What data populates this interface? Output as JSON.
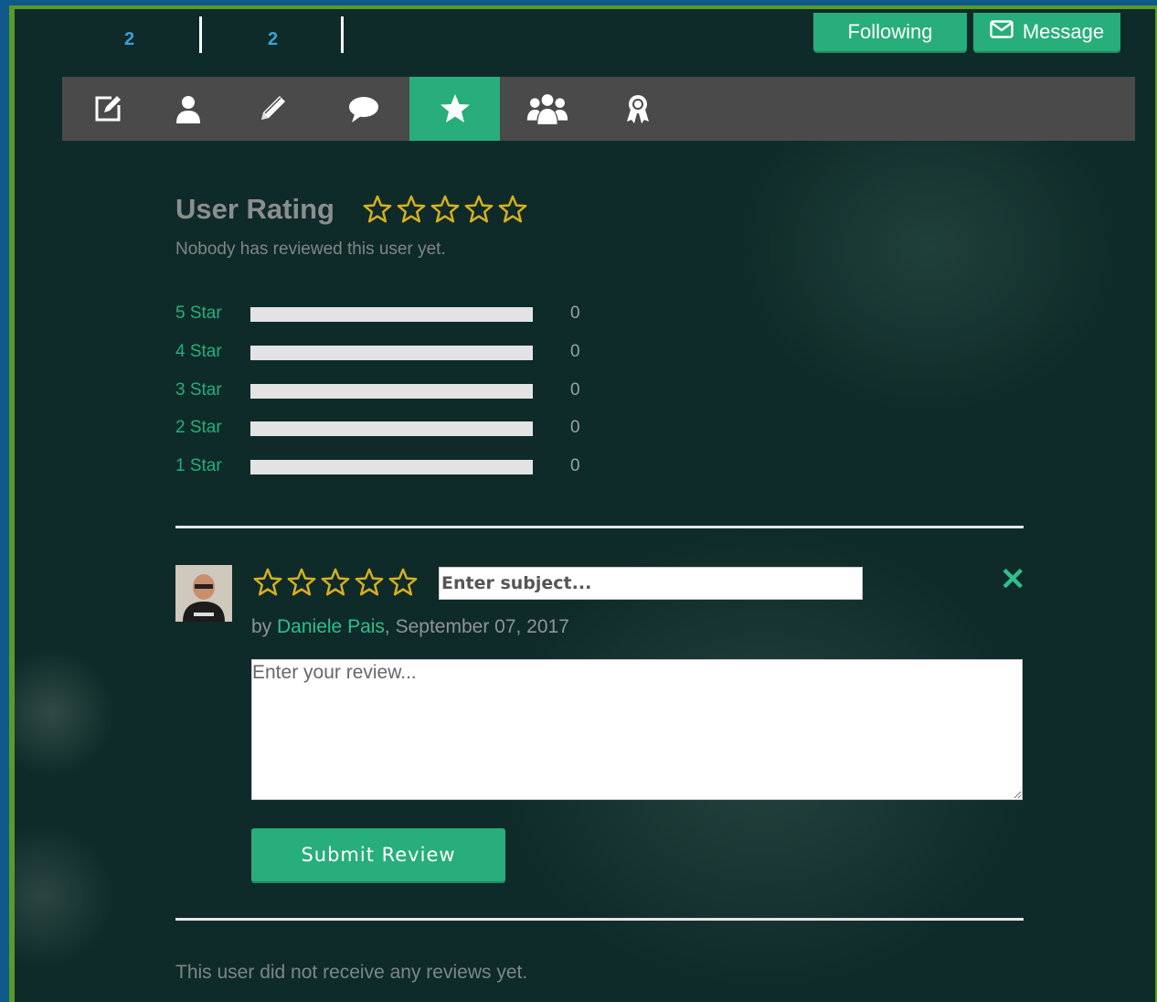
{
  "stats": [
    {
      "value": "2"
    },
    {
      "value": "2"
    }
  ],
  "header_buttons": {
    "following_label": "Following",
    "message_label": "Message"
  },
  "tabs": [
    {
      "icon": "edit-icon"
    },
    {
      "icon": "user-icon"
    },
    {
      "icon": "pencil-icon"
    },
    {
      "icon": "comment-icon"
    },
    {
      "icon": "star-icon",
      "active": true
    },
    {
      "icon": "users-icon"
    },
    {
      "icon": "award-icon"
    }
  ],
  "rating": {
    "title": "User Rating",
    "average_stars": 0,
    "max_stars": 5,
    "summary": "Nobody has reviewed this user yet.",
    "breakdown": [
      {
        "label": "5 Star",
        "count": "0",
        "fraction": 0
      },
      {
        "label": "4 Star",
        "count": "0",
        "fraction": 0
      },
      {
        "label": "3 Star",
        "count": "0",
        "fraction": 0
      },
      {
        "label": "2 Star",
        "count": "0",
        "fraction": 0
      },
      {
        "label": "1 Star",
        "count": "0",
        "fraction": 0
      }
    ]
  },
  "review_form": {
    "selected_stars": 0,
    "subject_placeholder": "Enter subject...",
    "subject_value": "",
    "by_prefix": "by ",
    "author": "Daniele Pais",
    "date": ", September 07, 2017",
    "review_placeholder": "Enter your review...",
    "submit_label": "Submit Review",
    "close_glyph": "✕"
  },
  "reviews_empty": "This user did not receive any reviews yet.",
  "colors": {
    "accent": "#27ae7a",
    "star": "#d8b020",
    "background": "#0f2b29",
    "tabbar": "#4a4a4a"
  }
}
